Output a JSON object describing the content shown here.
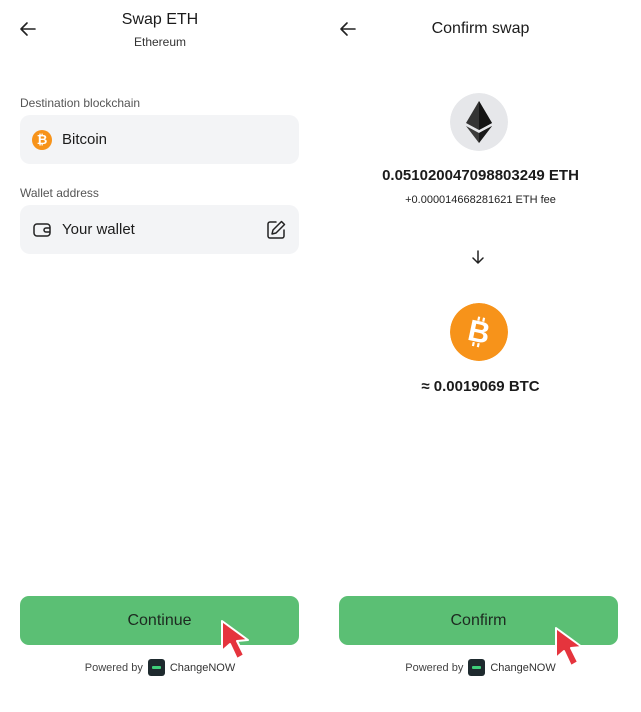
{
  "left": {
    "header": {
      "title": "Swap ETH",
      "subtitle": "Ethereum"
    },
    "destination": {
      "label": "Destination blockchain",
      "value": "Bitcoin"
    },
    "wallet": {
      "label": "Wallet address",
      "value": "Your wallet"
    },
    "continue_label": "Continue",
    "powered_prefix": "Powered by",
    "powered_brand": "ChangeNOW"
  },
  "right": {
    "header": {
      "title": "Confirm swap"
    },
    "from_amount": "0.051020047098803249 ETH",
    "fee": "+0.000014668281621 ETH fee",
    "to_amount": "≈ 0.0019069 BTC",
    "confirm_label": "Confirm",
    "powered_prefix": "Powered by",
    "powered_brand": "ChangeNOW"
  },
  "colors": {
    "accent": "#5bbf74",
    "bitcoin": "#f7931a",
    "field_bg": "#f3f4f6",
    "pointer": "#e5343d"
  },
  "icons": [
    "back-arrow-icon",
    "bitcoin-icon",
    "wallet-icon",
    "edit-icon",
    "ethereum-icon",
    "arrow-down-icon",
    "changenow-logo-icon",
    "mouse-pointer-icon"
  ]
}
